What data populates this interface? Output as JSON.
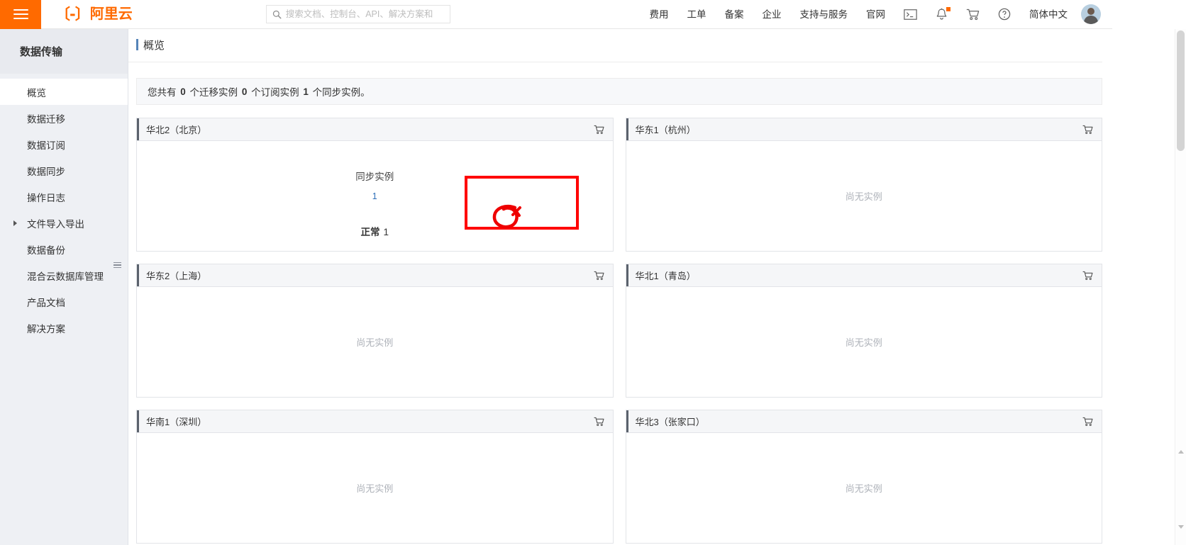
{
  "topbar": {
    "menu_icon": "hamburger-icon",
    "brand_mark": "〔-〕",
    "brand_text": "阿里云",
    "search": {
      "icon": "search-icon",
      "placeholder": "搜索文档、控制台、API、解决方案和",
      "value": ""
    },
    "nav_items": [
      {
        "label": "费用"
      },
      {
        "label": "工单"
      },
      {
        "label": "备案"
      },
      {
        "label": "企业"
      },
      {
        "label": "支持与服务"
      },
      {
        "label": "官网"
      }
    ],
    "icons": [
      {
        "name": "console-terminal-icon",
        "glyph": "▣"
      },
      {
        "name": "notifications-bell-icon",
        "glyph": "🔔",
        "badge": true
      },
      {
        "name": "shopping-cart-icon",
        "glyph": "🛒"
      },
      {
        "name": "help-circle-icon",
        "glyph": "?"
      }
    ],
    "language": "简体中文",
    "avatar": "user-avatar"
  },
  "sidebar": {
    "title": "数据传输",
    "items": [
      {
        "label": "概览",
        "active": true,
        "expandable": false
      },
      {
        "label": "数据迁移",
        "active": false,
        "expandable": false
      },
      {
        "label": "数据订阅",
        "active": false,
        "expandable": false
      },
      {
        "label": "数据同步",
        "active": false,
        "expandable": false
      },
      {
        "label": "操作日志",
        "active": false,
        "expandable": false
      },
      {
        "label": "文件导入导出",
        "active": false,
        "expandable": true
      },
      {
        "label": "数据备份",
        "active": false,
        "expandable": false
      },
      {
        "label": "混合云数据库管理",
        "active": false,
        "expandable": false
      },
      {
        "label": "产品文档",
        "active": false,
        "expandable": false
      },
      {
        "label": "解决方案",
        "active": false,
        "expandable": false
      }
    ]
  },
  "main": {
    "page_title": "概览",
    "summary": {
      "prefix": "您共有",
      "migration_count": "0",
      "migration_unit": "个迁移实例",
      "subscription_count": "0",
      "subscription_unit": "个订阅实例",
      "sync_count": "1",
      "sync_unit": "个同步实例",
      "suffix": "。"
    },
    "empty_text": "尚无实例",
    "cart_icon": "shopping-cart-icon",
    "regions": [
      {
        "title": "华北2（北京）",
        "has_instances": true,
        "stat_label": "同步实例",
        "stat_value": "1",
        "status_label": "正常",
        "status_count": "1"
      },
      {
        "title": "华东1（杭州）",
        "has_instances": false
      },
      {
        "title": "华东2（上海）",
        "has_instances": false
      },
      {
        "title": "华北1（青岛）",
        "has_instances": false
      },
      {
        "title": "华南1（深圳）",
        "has_instances": false
      },
      {
        "title": "华北3（张家口）",
        "has_instances": false
      }
    ]
  },
  "annotations": {
    "highlight_box": {
      "name": "red-highlight-rectangle",
      "color": "#ff0000"
    },
    "scribble": {
      "name": "red-circle-scribble",
      "color": "#ee0000"
    }
  }
}
